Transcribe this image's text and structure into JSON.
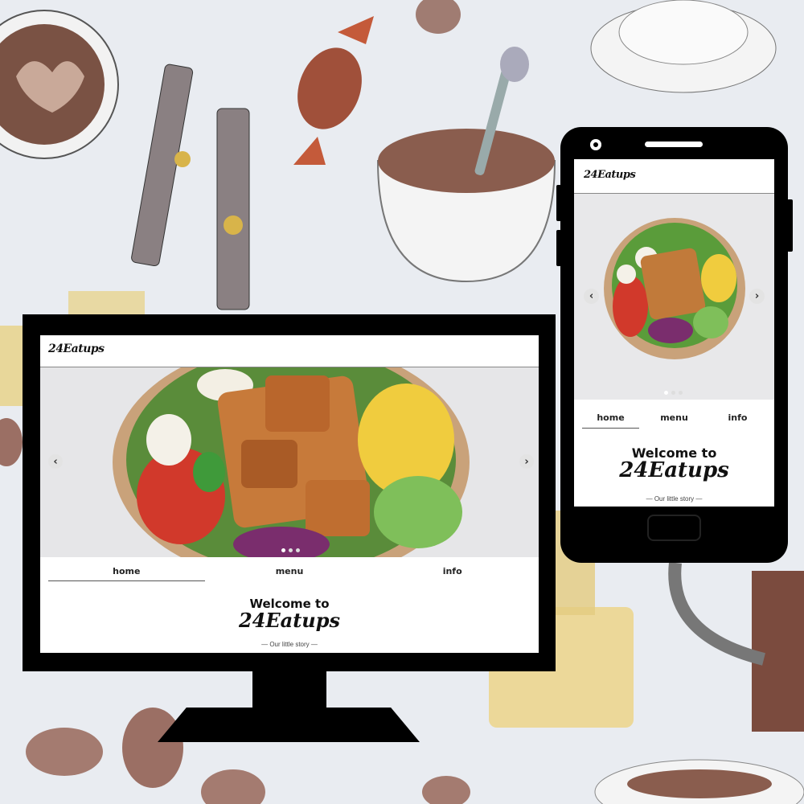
{
  "site": {
    "brand": "24Eatups",
    "nav": [
      "home",
      "menu",
      "info"
    ],
    "active_nav": "home",
    "welcome_line": "Welcome to",
    "welcome_brand": "24Eatups",
    "tagline": "— Our little story —",
    "carousel": {
      "prev_icon": "‹",
      "next_icon": "›",
      "slides": 3,
      "active_slide": 1
    }
  },
  "colors": {
    "device": "#000000",
    "screen": "#ffffff",
    "background": "#e9ecf1"
  },
  "icons": [
    "chevron-left-icon",
    "chevron-right-icon",
    "camera-icon",
    "speaker-icon",
    "home-button-icon"
  ]
}
